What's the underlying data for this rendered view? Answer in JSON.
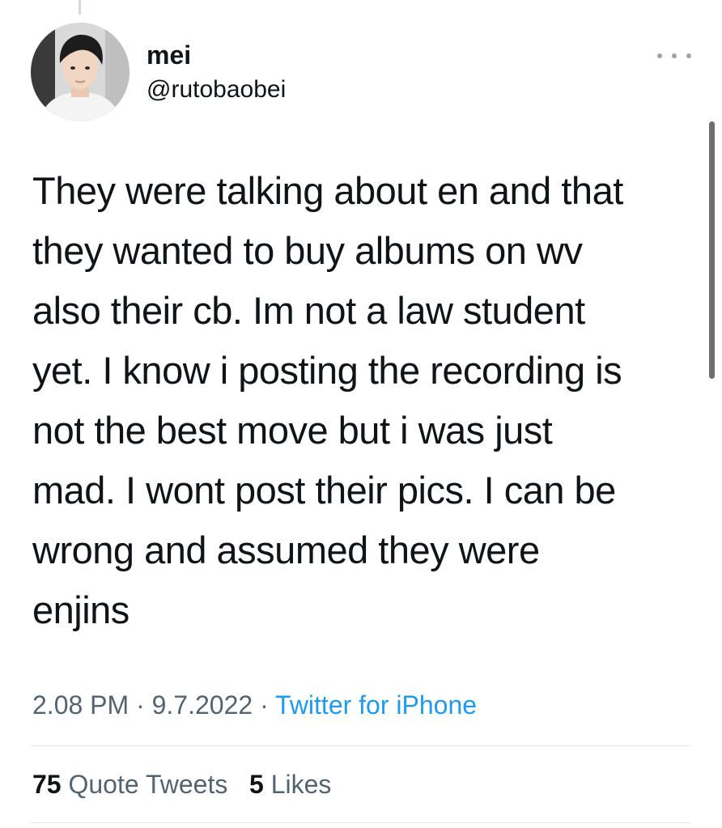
{
  "author": {
    "display_name": "mei",
    "handle": "@rutobaobei"
  },
  "icons": {
    "more": "more-horizontal-icon",
    "avatar": "profile-photo"
  },
  "tweet": {
    "text": "They were talking about en and that\nthey wanted to buy albums on wv\nalso their cb. Im not a law student\nyet. I know i posting the recording is\nnot the best move but i was just\nmad. I wont post their pics. I can be\nwrong and assumed they were\nenjins",
    "time": "2.08 PM",
    "separator1": " · ",
    "date": "9.7.2022",
    "separator2": " · ",
    "source": "Twitter for iPhone"
  },
  "stats": {
    "quote_tweets_count": "75",
    "quote_tweets_label": "Quote Tweets",
    "likes_count": "5",
    "likes_label": "Likes"
  },
  "colors": {
    "text_primary": "#0f1419",
    "text_secondary": "#536471",
    "link": "#1d9bf0",
    "divider": "#e1e8ed"
  }
}
